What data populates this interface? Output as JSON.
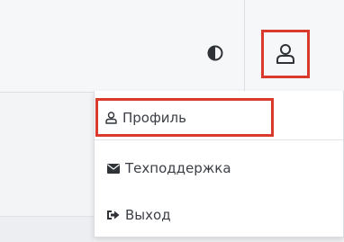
{
  "header": {
    "theme_toggle_icon": "contrast-icon",
    "profile_button_icon": "user-icon"
  },
  "dropdown": {
    "items": [
      {
        "label": "Профиль",
        "icon": "user-icon"
      },
      {
        "label": "Техподдержка",
        "icon": "envelope-icon"
      },
      {
        "label": "Выход",
        "icon": "sign-out-icon"
      }
    ]
  },
  "colors": {
    "highlight": "#d93a2b",
    "text": "#3b3f45",
    "icon": "#2f3337",
    "header_bg": "#f6f7f9"
  }
}
